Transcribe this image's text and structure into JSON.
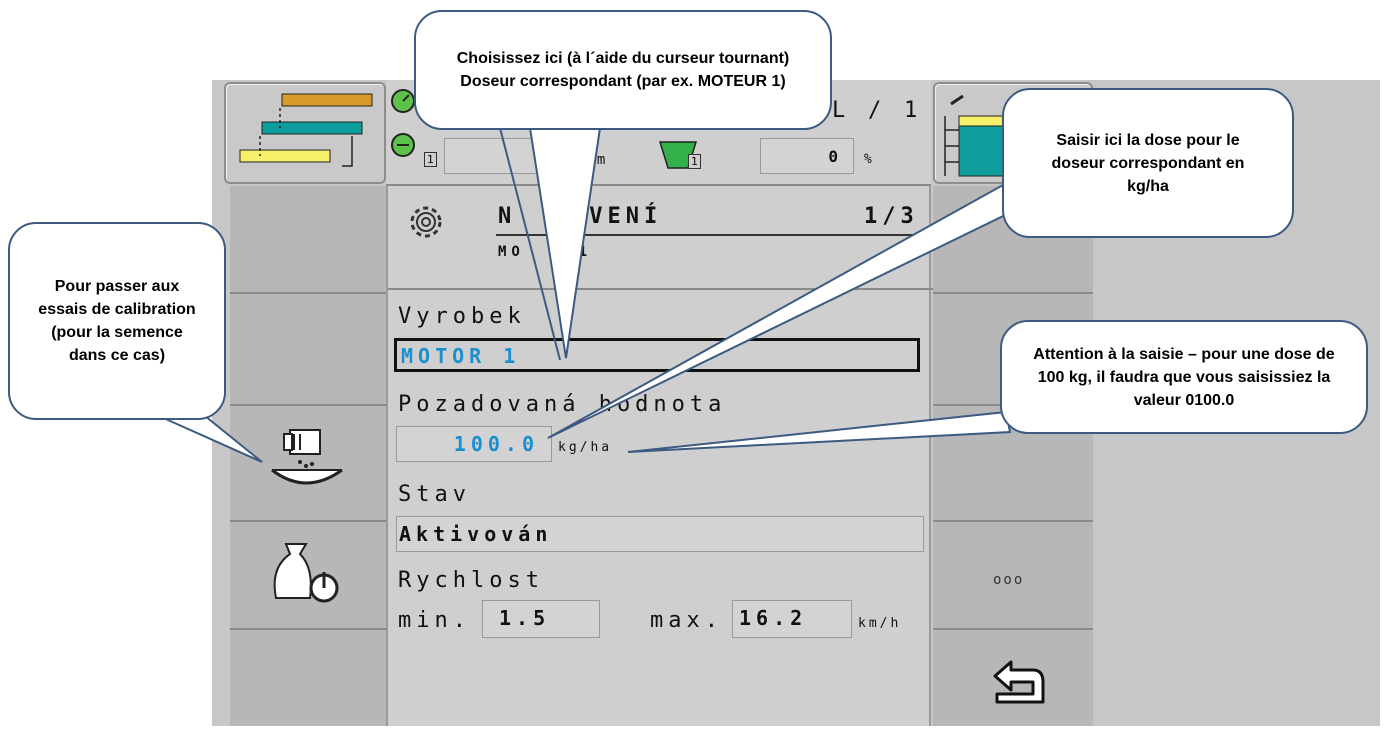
{
  "top_bar": {
    "counter_left": "L",
    "counter_sep": "/",
    "counter_right": "1",
    "unit_t_m": "t/m",
    "percent_value": "0",
    "percent_unit": "%",
    "hopper_badge": "1",
    "speed_badge": "1"
  },
  "panel": {
    "title": "N   AVENÍ",
    "subtitle": "MO    1",
    "page": "1/3",
    "product_label": "Vyrobek",
    "product_value": "MOTOR 1",
    "target_label": "Pozadovaná hodnota",
    "target_value": "100.0",
    "target_unit": "kg/ha",
    "status_label": "Stav",
    "status_value": "Aktivován",
    "speed_label": "Rychlost",
    "min_label": "min.",
    "min_value": "1.5",
    "max_label": "max.",
    "max_value": "16.2",
    "speed_unit": "km/h"
  },
  "right_side": {
    "more_label": "ooo"
  },
  "callouts": {
    "choose_dosing": "Choisissez ici (à l´aide du curseur tournant) Doseur correspondant (par ex. MOTEUR  1)",
    "enter_dose": "Saisir ici la dose pour le doseur correspondant en kg/ha",
    "calibration": "Pour passer aux essais de calibration (pour la semence dans ce cas)",
    "attention": "Attention à la saisie – pour une dose de 100 kg, il faudra que vous saisissiez la valeur 0100.0"
  },
  "colors": {
    "accent_blue": "#1b8fd0",
    "teal": "#0f9c9c",
    "yellow": "#f5ef6a",
    "orange": "#d99a2b"
  }
}
